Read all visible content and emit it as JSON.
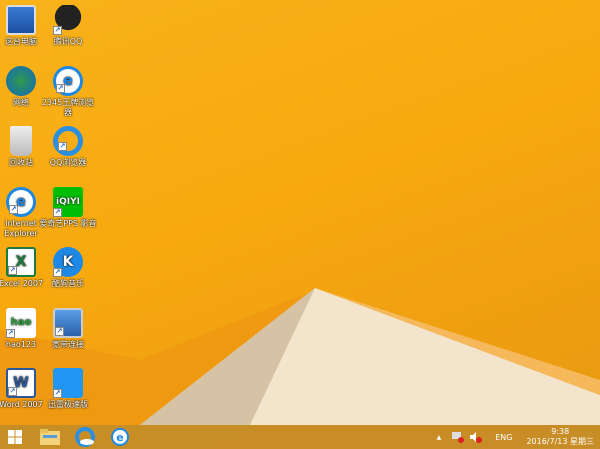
{
  "desktop": {
    "icons": [
      {
        "label": "这台电脑",
        "icon": "computer-icon"
      },
      {
        "label": "腾讯QQ",
        "icon": "qq-penguin-icon"
      },
      {
        "label": "网络",
        "icon": "network-icon"
      },
      {
        "label": "2345王牌浏览器",
        "icon": "2345-browser-icon"
      },
      {
        "label": "回收站",
        "icon": "recycle-bin-icon"
      },
      {
        "label": "QQ浏览器",
        "icon": "qq-browser-icon"
      },
      {
        "label": "Internet Explorer",
        "icon": "ie-icon"
      },
      {
        "label": "爱奇艺PPS 影音",
        "icon": "iqiyi-icon",
        "glyph": "iQIYI"
      },
      {
        "label": "Excel 2007",
        "icon": "excel-icon",
        "glyph": "X"
      },
      {
        "label": "酷狗音乐",
        "icon": "kugou-icon",
        "glyph": "K"
      },
      {
        "label": "hao123",
        "icon": "hao123-icon",
        "glyph": "hao"
      },
      {
        "label": "宽带连接",
        "icon": "broadband-connection-icon"
      },
      {
        "label": "Word 2007",
        "icon": "word-icon",
        "glyph": "W"
      },
      {
        "label": "迅雷极速版",
        "icon": "thunder-icon"
      }
    ]
  },
  "taskbar": {
    "apps": [
      "start-icon",
      "file-explorer-icon",
      "qq-browser-icon",
      "2345-browser-icon"
    ],
    "tray": {
      "language": "ENG",
      "time": "9:38",
      "date": "2016/7/13 星期三",
      "show_hidden": "▲"
    }
  },
  "colors": {
    "background": "#f7a90f",
    "taskbar": "#c48c28"
  }
}
